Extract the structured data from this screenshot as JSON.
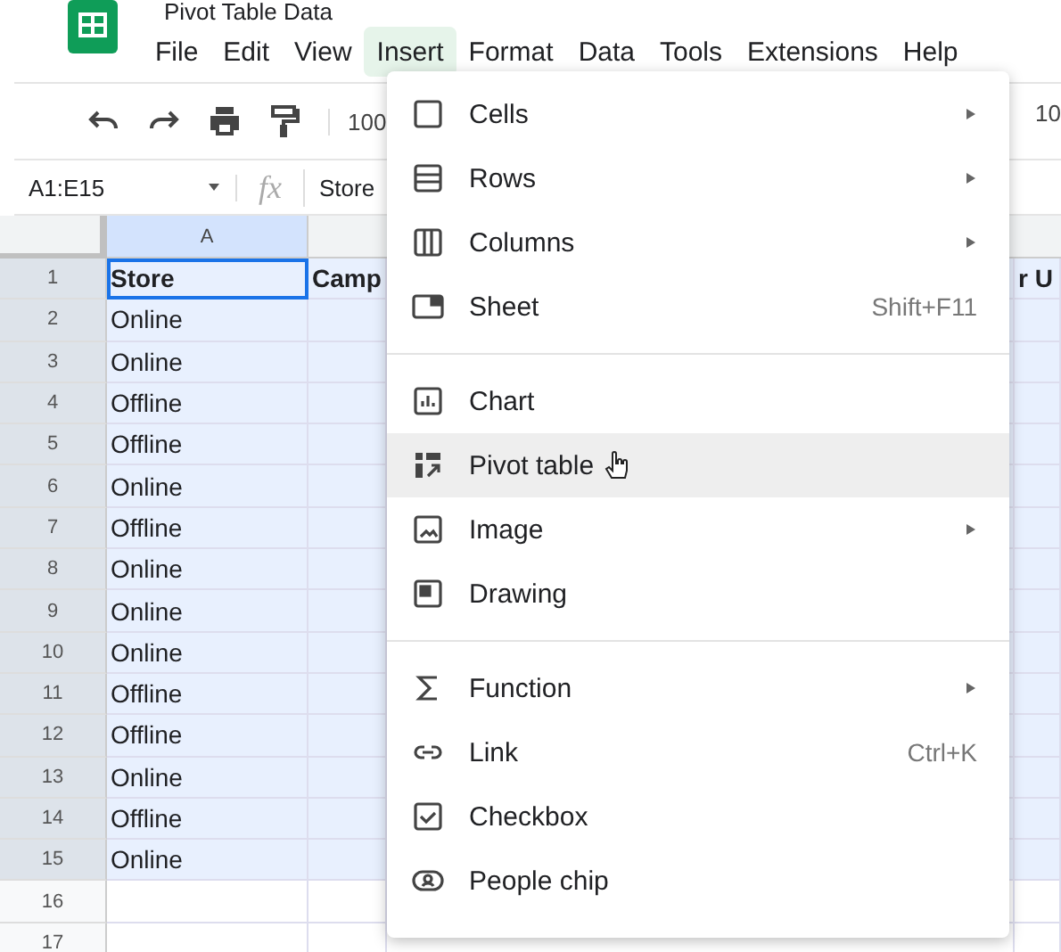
{
  "document": {
    "title": "Pivot Table Data"
  },
  "menubar": [
    {
      "label": "File",
      "selected": false
    },
    {
      "label": "Edit",
      "selected": false
    },
    {
      "label": "View",
      "selected": false
    },
    {
      "label": "Insert",
      "selected": true
    },
    {
      "label": "Format",
      "selected": false
    },
    {
      "label": "Data",
      "selected": false
    },
    {
      "label": "Tools",
      "selected": false
    },
    {
      "label": "Extensions",
      "selected": false
    },
    {
      "label": "Help",
      "selected": false
    }
  ],
  "toolbar": {
    "zoom": "100",
    "font_size": "10"
  },
  "formula_bar": {
    "name_box": "A1:E15",
    "function_label": "fx",
    "formula": "Store"
  },
  "sheet": {
    "column_headers": [
      "A"
    ],
    "header_row": {
      "number": "1",
      "cells": [
        "Store",
        "Camp",
        "r U"
      ]
    },
    "rows": [
      {
        "number": "2",
        "value": "Online",
        "in_selection": true
      },
      {
        "number": "3",
        "value": "Online",
        "in_selection": true
      },
      {
        "number": "4",
        "value": "Offline",
        "in_selection": true
      },
      {
        "number": "5",
        "value": "Offline",
        "in_selection": true
      },
      {
        "number": "6",
        "value": "Online",
        "in_selection": true
      },
      {
        "number": "7",
        "value": "Offline",
        "in_selection": true
      },
      {
        "number": "8",
        "value": "Online",
        "in_selection": true
      },
      {
        "number": "9",
        "value": "Online",
        "in_selection": true
      },
      {
        "number": "10",
        "value": "Online",
        "in_selection": true
      },
      {
        "number": "11",
        "value": "Offline",
        "in_selection": true
      },
      {
        "number": "12",
        "value": "Offline",
        "in_selection": true
      },
      {
        "number": "13",
        "value": "Online",
        "in_selection": true
      },
      {
        "number": "14",
        "value": "Offline",
        "in_selection": true
      },
      {
        "number": "15",
        "value": "Online",
        "in_selection": true
      },
      {
        "number": "16",
        "value": "",
        "in_selection": false
      },
      {
        "number": "17",
        "value": "",
        "in_selection": false
      }
    ]
  },
  "insert_menu": [
    {
      "kind": "item",
      "label": "Cells",
      "submenu": true,
      "selected": false
    },
    {
      "kind": "item",
      "label": "Rows",
      "submenu": true,
      "selected": false
    },
    {
      "kind": "item",
      "label": "Columns",
      "submenu": true,
      "selected": false
    },
    {
      "kind": "item",
      "label": "Sheet",
      "shortcut": "Shift+F11",
      "submenu": false,
      "selected": false
    },
    {
      "kind": "separator"
    },
    {
      "kind": "item",
      "label": "Chart",
      "submenu": false,
      "selected": false
    },
    {
      "kind": "item",
      "label": "Pivot table",
      "submenu": false,
      "selected": true
    },
    {
      "kind": "item",
      "label": "Image",
      "submenu": true,
      "selected": false
    },
    {
      "kind": "item",
      "label": "Drawing",
      "submenu": false,
      "selected": false
    },
    {
      "kind": "separator"
    },
    {
      "kind": "item",
      "label": "Function",
      "submenu": true,
      "selected": false
    },
    {
      "kind": "item",
      "label": "Link",
      "shortcut": "Ctrl+K",
      "submenu": false,
      "selected": false
    },
    {
      "kind": "item",
      "label": "Checkbox",
      "submenu": false,
      "selected": false
    },
    {
      "kind": "item",
      "label": "People chip",
      "submenu": false,
      "selected": false
    }
  ]
}
